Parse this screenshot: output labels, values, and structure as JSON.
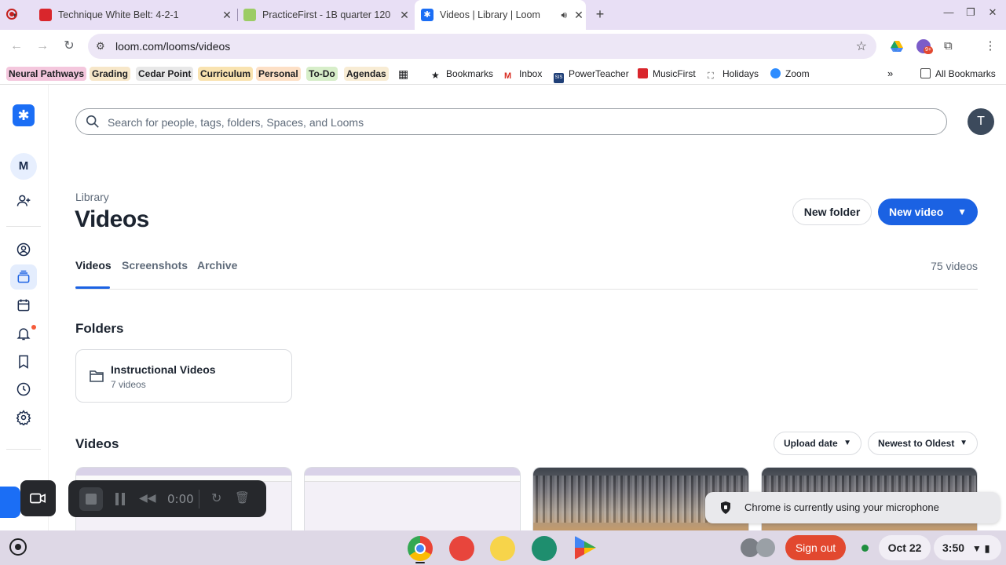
{
  "browser": {
    "tabs": [
      {
        "title": "Technique White Belt: 4-2-1",
        "active": false
      },
      {
        "title": "PracticeFirst - 1B quarter 120",
        "active": false
      },
      {
        "title": "Videos | Library | Loom",
        "active": true
      }
    ],
    "url": "loom.com/looms/videos",
    "bookmarks": [
      {
        "label": "Neural Pathways",
        "color": "#f4c7dd"
      },
      {
        "label": "Grading",
        "color": "#f7e7c9"
      },
      {
        "label": "Cedar Point",
        "color": "#e8e8e8"
      },
      {
        "label": "Curriculum",
        "color": "#f9e3b0"
      },
      {
        "label": "Personal",
        "color": "#fde0c6"
      },
      {
        "label": "To-Do",
        "color": "#d7eec9"
      },
      {
        "label": "Agendas",
        "color": "#f8ecd4"
      }
    ],
    "bookmark_links": [
      {
        "label": "Bookmarks",
        "icon": "star-icon"
      },
      {
        "label": "Inbox",
        "icon": "gmail-icon"
      },
      {
        "label": "PowerTeacher",
        "icon": "sis-icon"
      },
      {
        "label": "MusicFirst",
        "icon": "musicfirst-icon"
      },
      {
        "label": "Holidays",
        "icon": "calendar-icon"
      },
      {
        "label": "Zoom",
        "icon": "zoom-icon"
      }
    ],
    "all_bookmarks": "All Bookmarks",
    "sis_badge": "SIS",
    "ext_badge": "9+"
  },
  "sidebar": {
    "workspace_initial": "M"
  },
  "header": {
    "search_placeholder": "Search for people, tags, folders, Spaces, and Looms",
    "avatar_initial": "T"
  },
  "page": {
    "breadcrumb": "Library",
    "title": "Videos",
    "new_folder": "New folder",
    "new_video": "New video",
    "tabs": [
      "Videos",
      "Screenshots",
      "Archive"
    ],
    "video_count": "75 videos",
    "folders_heading": "Folders",
    "folder": {
      "name": "Instructional Videos",
      "count": "7 videos"
    },
    "videos_heading": "Videos",
    "sort_by": "Upload date",
    "sort_order": "Newest to Oldest"
  },
  "recorder": {
    "time": "0:00"
  },
  "toast": {
    "message": "Chrome is currently using your microphone"
  },
  "shelf": {
    "sign_out": "Sign out",
    "date": "Oct 22",
    "time": "3:50"
  },
  "colors": {
    "accent": "#1b62e3",
    "signout": "#e2482f",
    "tabstrip": "#e8dff5"
  }
}
